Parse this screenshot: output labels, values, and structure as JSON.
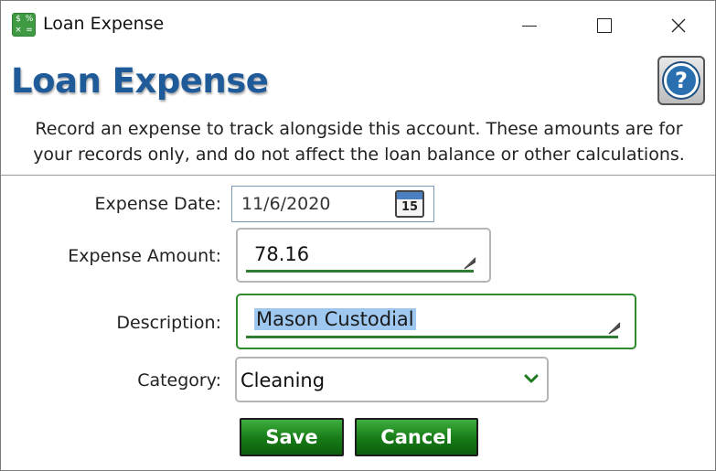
{
  "window": {
    "title": "Loan Expense",
    "icon": "spreadsheet-calculator-icon"
  },
  "header": {
    "heading": "Loan Expense",
    "help_icon": "question-mark-icon",
    "help_glyph": "?",
    "description": "Record an expense to track alongside this account. These amounts are for your records only, and do not affect the loan balance or other calculations."
  },
  "form": {
    "date_label": "Expense Date:",
    "date_value": "11/6/2020",
    "calendar_day": "15",
    "amount_label": "Expense Amount:",
    "amount_value": "78.16",
    "description_label": "Description:",
    "description_value": "Mason Custodial",
    "category_label": "Category:",
    "category_value": "Cleaning"
  },
  "buttons": {
    "save": "Save",
    "cancel": "Cancel"
  },
  "colors": {
    "heading": "#1f5a99",
    "accent_green": "#2e7d32",
    "selection": "#9fc8f0"
  }
}
